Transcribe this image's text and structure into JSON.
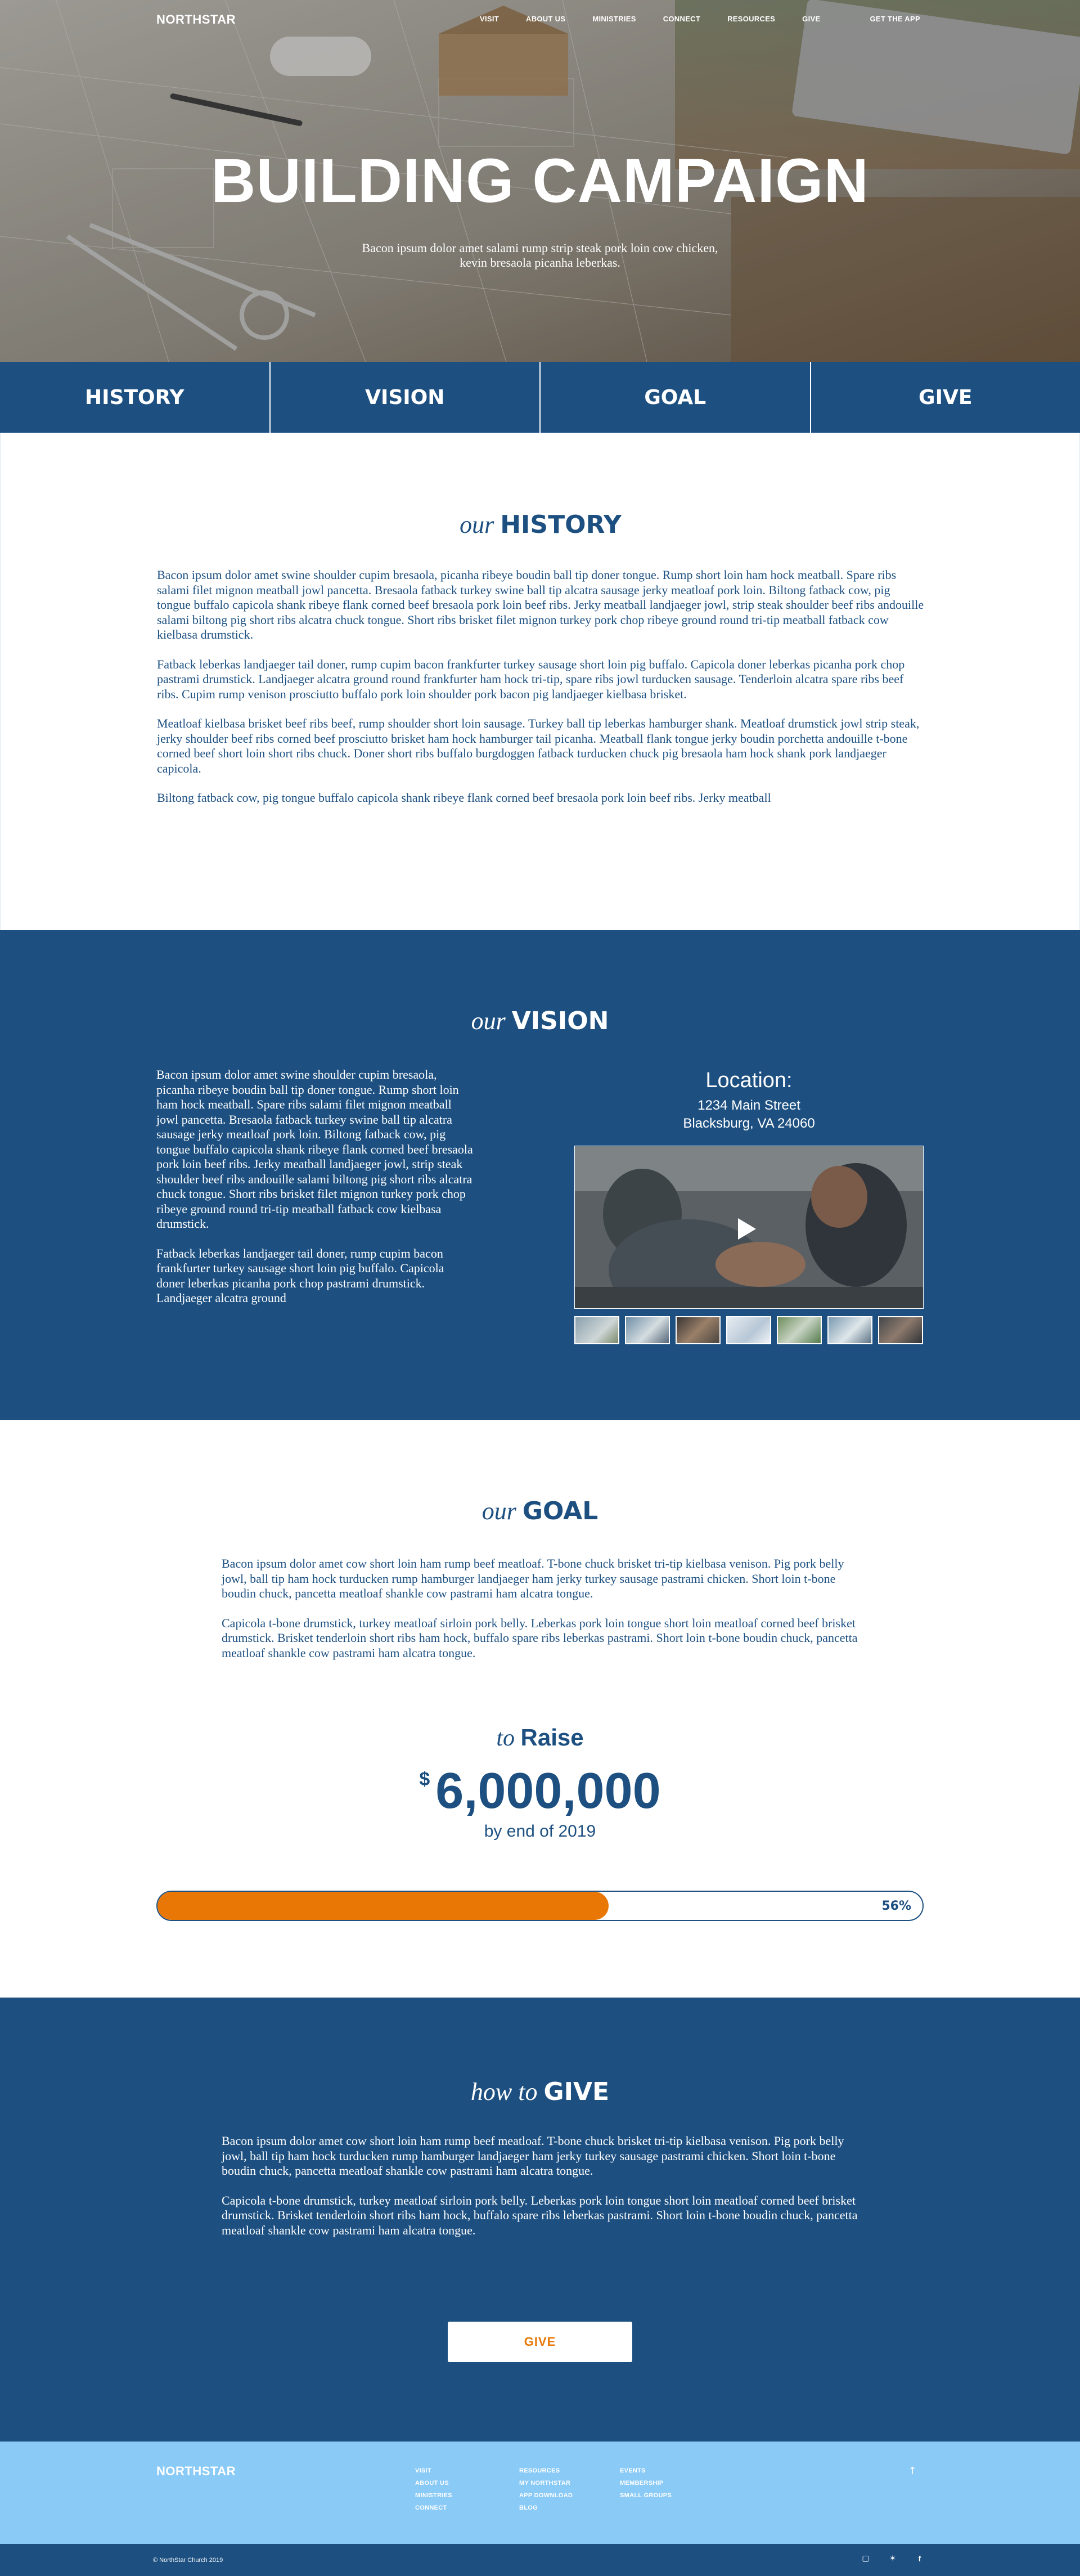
{
  "brand": {
    "logo": "NORTHSTAR"
  },
  "nav": {
    "items": [
      "VISIT",
      "ABOUT US",
      "MINISTRIES",
      "CONNECT",
      "RESOURCES",
      "GIVE"
    ],
    "cta": "GET THE APP"
  },
  "hero": {
    "title": "BUILDING CAMPAIGN",
    "subtitle": "Bacon ipsum dolor amet salami rump strip steak pork loin cow chicken, kevin bresaola picanha leberkas."
  },
  "tabs": [
    "HISTORY",
    "VISION",
    "GOAL",
    "GIVE"
  ],
  "history": {
    "heading_lead": "our",
    "heading_main": "HISTORY",
    "paragraphs": [
      "Bacon ipsum dolor amet swine shoulder cupim bresaola, picanha ribeye boudin ball tip doner tongue. Rump short loin ham hock meatball. Spare ribs salami filet mignon meatball jowl pancetta. Bresaola fatback turkey swine ball tip alcatra sausage jerky meatloaf pork loin. Biltong fatback cow, pig tongue buffalo capicola shank ribeye flank corned beef bresaola pork loin beef ribs. Jerky meatball landjaeger jowl, strip steak shoulder beef ribs andouille salami biltong pig short ribs alcatra chuck tongue. Short ribs brisket filet mignon turkey pork chop ribeye ground round tri-tip meatball fatback cow kielbasa drumstick.",
      "Fatback leberkas landjaeger tail doner, rump cupim bacon frankfurter turkey sausage short loin pig buffalo. Capicola doner leberkas picanha pork chop pastrami drumstick. Landjaeger alcatra ground round frankfurter ham hock tri-tip, spare ribs jowl turducken sausage. Tenderloin alcatra spare ribs beef ribs. Cupim rump venison prosciutto buffalo pork loin shoulder pork bacon pig landjaeger kielbasa brisket.",
      "Meatloaf kielbasa brisket beef ribs beef, rump shoulder short loin sausage. Turkey ball tip leberkas hamburger shank. Meatloaf drumstick jowl strip steak, jerky shoulder beef ribs corned beef prosciutto brisket ham hock hamburger tail picanha. Meatball flank tongue jerky boudin porchetta andouille t-bone corned beef short loin short ribs chuck. Doner short ribs buffalo burgdoggen fatback turducken chuck pig bresaola ham hock shank pork landjaeger capicola.",
      "Biltong fatback cow, pig tongue buffalo capicola shank ribeye flank corned beef bresaola pork loin beef ribs. Jerky meatball"
    ]
  },
  "vision": {
    "heading_lead": "our",
    "heading_main": "VISION",
    "paragraphs": [
      "Bacon ipsum dolor amet swine shoulder cupim bresaola, picanha ribeye boudin ball tip doner tongue. Rump short loin ham hock meatball. Spare ribs salami filet mignon meatball jowl pancetta. Bresaola fatback turkey swine ball tip alcatra sausage jerky meatloaf pork loin. Biltong fatback cow, pig tongue buffalo capicola shank ribeye flank corned beef bresaola pork loin beef ribs. Jerky meatball landjaeger jowl, strip steak shoulder beef ribs andouille salami biltong pig short ribs alcatra chuck tongue. Short ribs brisket filet mignon turkey pork chop ribeye ground round tri-tip meatball fatback cow kielbasa drumstick.",
      "Fatback leberkas landjaeger tail doner, rump cupim bacon frankfurter turkey sausage short loin pig buffalo. Capicola doner leberkas picanha pork chop pastrami drumstick. Landjaeger alcatra ground"
    ],
    "location": {
      "title": "Location:",
      "street": "1234 Main Street",
      "city": "Blacksburg, VA 24060"
    },
    "play_icon": "play-icon"
  },
  "goal": {
    "heading_lead": "our",
    "heading_main": "GOAL",
    "paragraphs": [
      "Bacon ipsum dolor amet cow short loin ham rump beef meatloaf. T-bone chuck brisket tri-tip kielbasa venison. Pig pork belly jowl, ball tip ham hock turducken rump hamburger landjaeger ham jerky turkey sausage pastrami chicken. Short loin t-bone boudin chuck, pancetta meatloaf shankle cow pastrami ham alcatra tongue.",
      "Capicola t-bone drumstick, turkey meatloaf sirloin pork belly. Leberkas pork loin tongue short loin meatloaf corned beef brisket drumstick. Brisket tenderloin short ribs ham hock, buffalo spare ribs leberkas pastrami. Short loin t-bone boudin chuck, pancetta meatloaf shankle cow pastrami ham alcatra tongue."
    ],
    "raise": {
      "lead": "to",
      "main": "Raise",
      "currency": "$",
      "amount": "6,000,000",
      "deadline": "by end of 2019"
    },
    "progress": {
      "label": "56%",
      "fraction": 0.59
    }
  },
  "give": {
    "heading_lead": "how to",
    "heading_main": "GIVE",
    "paragraphs": [
      "Bacon ipsum dolor amet cow short loin ham rump beef meatloaf. T-bone chuck brisket tri-tip kielbasa venison. Pig pork belly jowl, ball tip ham hock turducken rump hamburger landjaeger ham jerky turkey sausage pastrami chicken. Short loin t-bone boudin chuck, pancetta meatloaf shankle cow pastrami ham alcatra tongue.",
      "Capicola t-bone drumstick, turkey meatloaf sirloin pork belly. Leberkas pork loin tongue short loin meatloaf corned beef brisket drumstick. Brisket tenderloin short ribs ham hock, buffalo spare ribs leberkas pastrami. Short loin t-bone boudin chuck, pancetta meatloaf shankle cow pastrami ham alcatra tongue."
    ],
    "button": "GIVE"
  },
  "footer": {
    "logo": "NORTHSTAR",
    "col1": [
      "VISIT",
      "ABOUT US",
      "MINISTRIES",
      "CONNECT"
    ],
    "col2": [
      "RESOURCES",
      "MY NORTHSTAR",
      "APP DOWNLOAD",
      "BLOG"
    ],
    "col3": [
      "EVENTS",
      "MEMBERSHIP",
      "SMALL GROUPS"
    ],
    "copyright": "© NorthStar Church 2019",
    "social_icons": [
      "instagram-icon",
      "twitter-icon",
      "facebook-icon"
    ]
  },
  "colors": {
    "primary": "#1d5081",
    "accent": "#e87705",
    "footer_light": "#8acaf6"
  }
}
